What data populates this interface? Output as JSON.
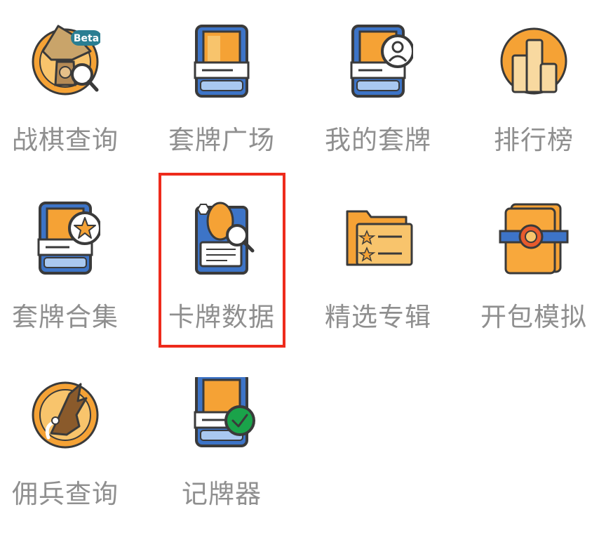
{
  "menu": {
    "items": [
      {
        "label": "战棋查询",
        "icon": "battleground-search-icon",
        "badge": "Beta"
      },
      {
        "label": "套牌广场",
        "icon": "deck-square-icon"
      },
      {
        "label": "我的套牌",
        "icon": "my-deck-icon"
      },
      {
        "label": "排行榜",
        "icon": "leaderboard-icon"
      },
      {
        "label": "套牌合集",
        "icon": "deck-collection-icon"
      },
      {
        "label": "卡牌数据",
        "icon": "card-data-icon",
        "selected": true
      },
      {
        "label": "精选专辑",
        "icon": "featured-album-icon"
      },
      {
        "label": "开包模拟",
        "icon": "pack-opening-icon"
      },
      {
        "label": "佣兵查询",
        "icon": "mercenary-search-icon"
      },
      {
        "label": "记牌器",
        "icon": "deck-tracker-icon"
      }
    ]
  },
  "colors": {
    "accent_orange": "#f5a235",
    "card_blue": "#3d74c7",
    "outline": "#3a3a3a",
    "label_gray": "#8f8f8f",
    "highlight_red": "#ee2b1c",
    "badge_teal": "#2a7e92",
    "tracker_green": "#1aa34a"
  }
}
